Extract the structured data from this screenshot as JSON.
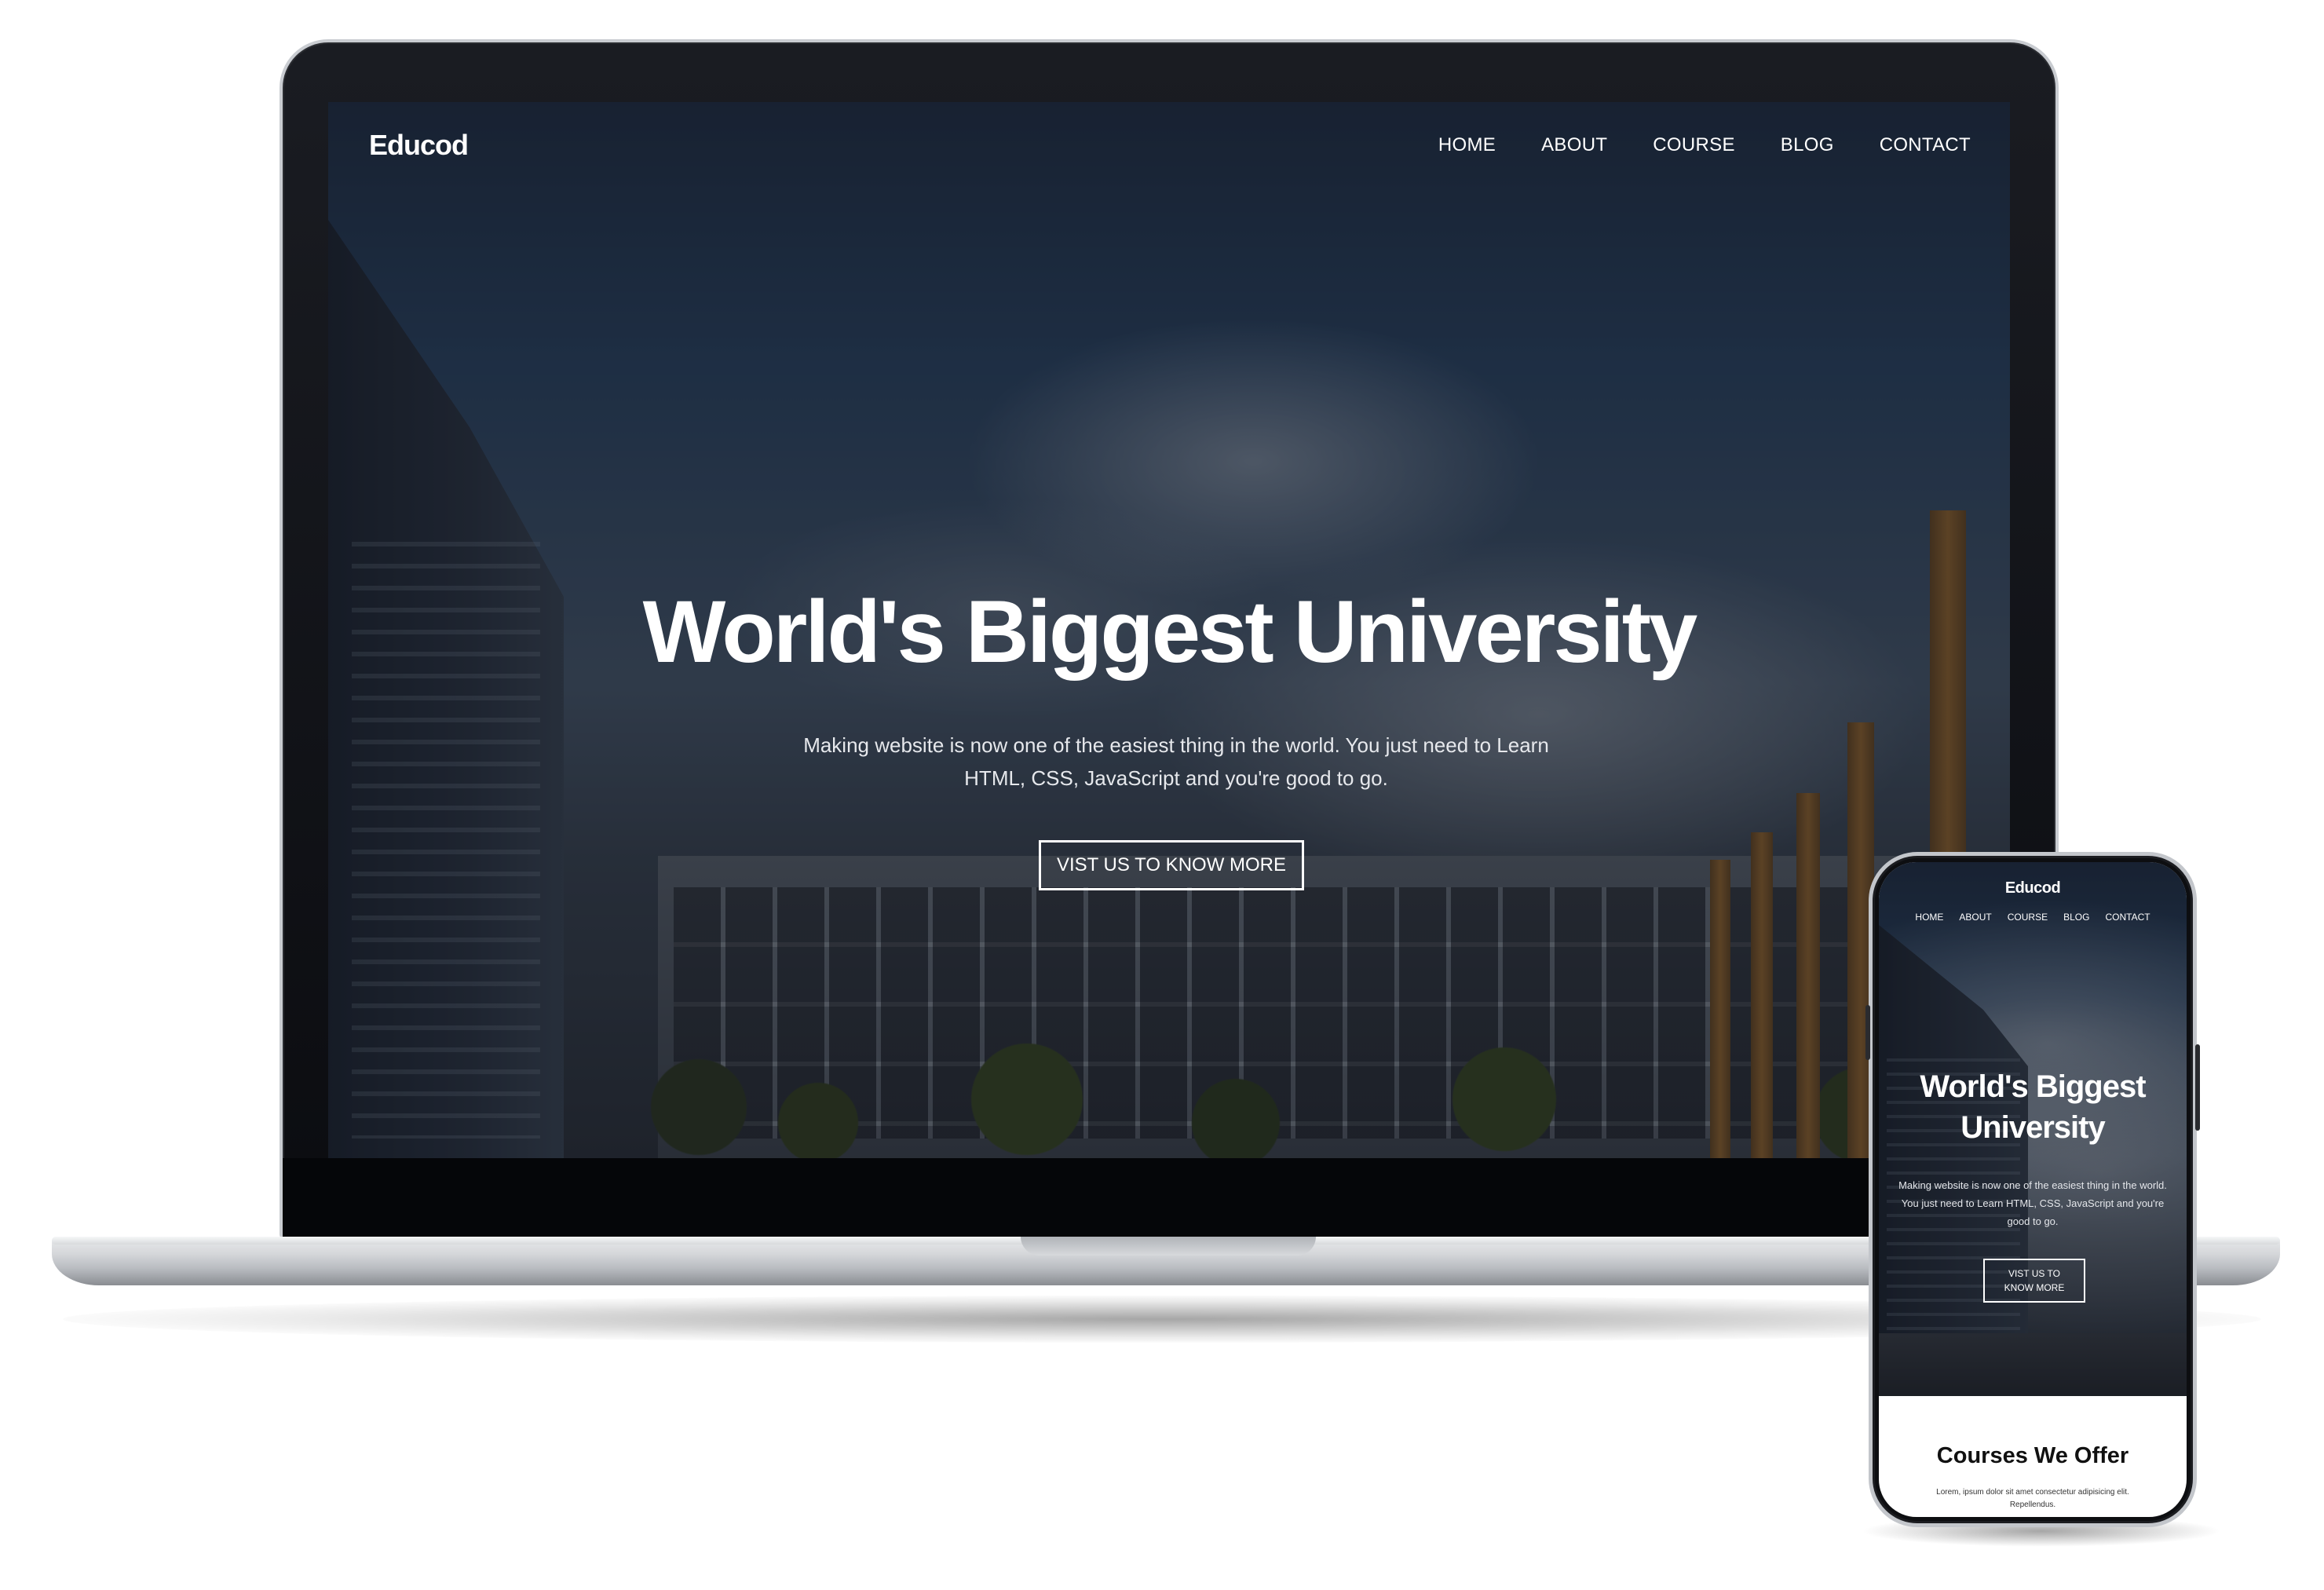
{
  "site": {
    "logo": "Educod",
    "nav": [
      "HOME",
      "ABOUT",
      "COURSE",
      "BLOG",
      "CONTACT"
    ],
    "hero": {
      "title": "World's Biggest University",
      "description": "Making website is now one of the easiest thing in the world. You just need to Learn HTML, CSS, JavaScript and you're good to go.",
      "button": "VIST US TO KNOW MORE"
    }
  },
  "mobile": {
    "logo": "Educod",
    "nav": [
      "HOME",
      "ABOUT",
      "COURSE",
      "BLOG",
      "CONTACT"
    ],
    "hero": {
      "title_line1": "World's Biggest",
      "title_line2": "University",
      "description": "Making website is now one of the easiest thing in the world. You just need to Learn HTML, CSS, JavaScript and you're good to go.",
      "button_line1": "VIST US TO",
      "button_line2": "KNOW MORE"
    },
    "courses": {
      "title": "Courses We Offer",
      "description": "Lorem, ipsum dolor sit amet consectetur adipisicing elit. Repellendus."
    }
  },
  "colors": {
    "text_on_hero": "#ffffff",
    "overlay": "#0f121a",
    "device_frame": "#0d0e11",
    "aluminum": "#c9ccd1"
  }
}
